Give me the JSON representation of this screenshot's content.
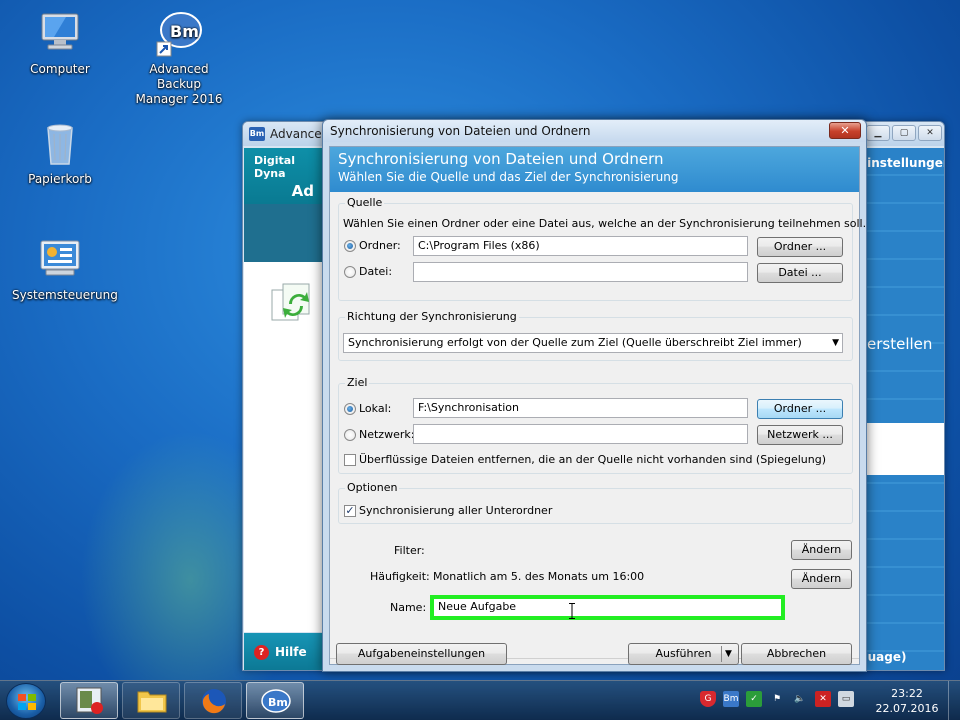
{
  "desktop": {
    "icons": [
      {
        "label": "Computer"
      },
      {
        "label": "Advanced Backup Manager 2016"
      },
      {
        "label": "Papierkorb"
      },
      {
        "label": "Systemsteuerung"
      }
    ]
  },
  "background_window": {
    "title": "Advanced",
    "header_line1": "Digital Dyna",
    "header_line2": "Ad",
    "help_label": "Hilfe",
    "right_label1": "einstellungen",
    "right_label2": "erstellen",
    "right_label3": "guage)"
  },
  "dialog": {
    "title": "Synchronisierung von Dateien und Ordnern",
    "close_label": "✕",
    "header_title": "Synchronisierung von Dateien und Ordnern",
    "header_subtitle": "Wählen Sie die Quelle und das Ziel der Synchronisierung",
    "source": {
      "legend": "Quelle",
      "description": "Wählen Sie einen Ordner oder eine Datei aus, welche an der Synchronisierung teilnehmen soll.",
      "folder_label": "Ordner:",
      "folder_value": "C:\\Program Files (x86)",
      "folder_button": "Ordner ...",
      "file_label": "Datei:",
      "file_value": "",
      "file_button": "Datei ..."
    },
    "direction": {
      "legend": "Richtung der Synchronisierung",
      "selected": "Synchronisierung erfolgt von der Quelle zum Ziel (Quelle überschreibt Ziel immer)"
    },
    "target": {
      "legend": "Ziel",
      "local_label": "Lokal:",
      "local_value": "F:\\Synchronisation",
      "local_button": "Ordner ...",
      "network_label": "Netzwerk:",
      "network_value": "",
      "network_button": "Netzwerk ...",
      "mirror_label": "Überflüssige Dateien entfernen, die an der Quelle nicht vorhanden sind (Spiegelung)",
      "mirror_checked": false
    },
    "options": {
      "legend": "Optionen",
      "subfolders_label": "Synchronisierung aller Unterordner",
      "subfolders_checked": true
    },
    "filter_label": "Filter:",
    "filter_button": "Ändern",
    "frequency_label": "Häufigkeit:",
    "frequency_value": "Monatlich am 5. des Monats um 16:00",
    "frequency_button": "Ändern",
    "name_label": "Name:",
    "name_value": "Neue Aufgabe",
    "task_settings_button": "Aufgabeneinstellungen",
    "run_button": "Ausführen",
    "cancel_button": "Abbrechen",
    "highlight_color": "#22ee22"
  },
  "taskbar": {
    "clock_time": "23:22",
    "clock_date": "22.07.2016"
  }
}
